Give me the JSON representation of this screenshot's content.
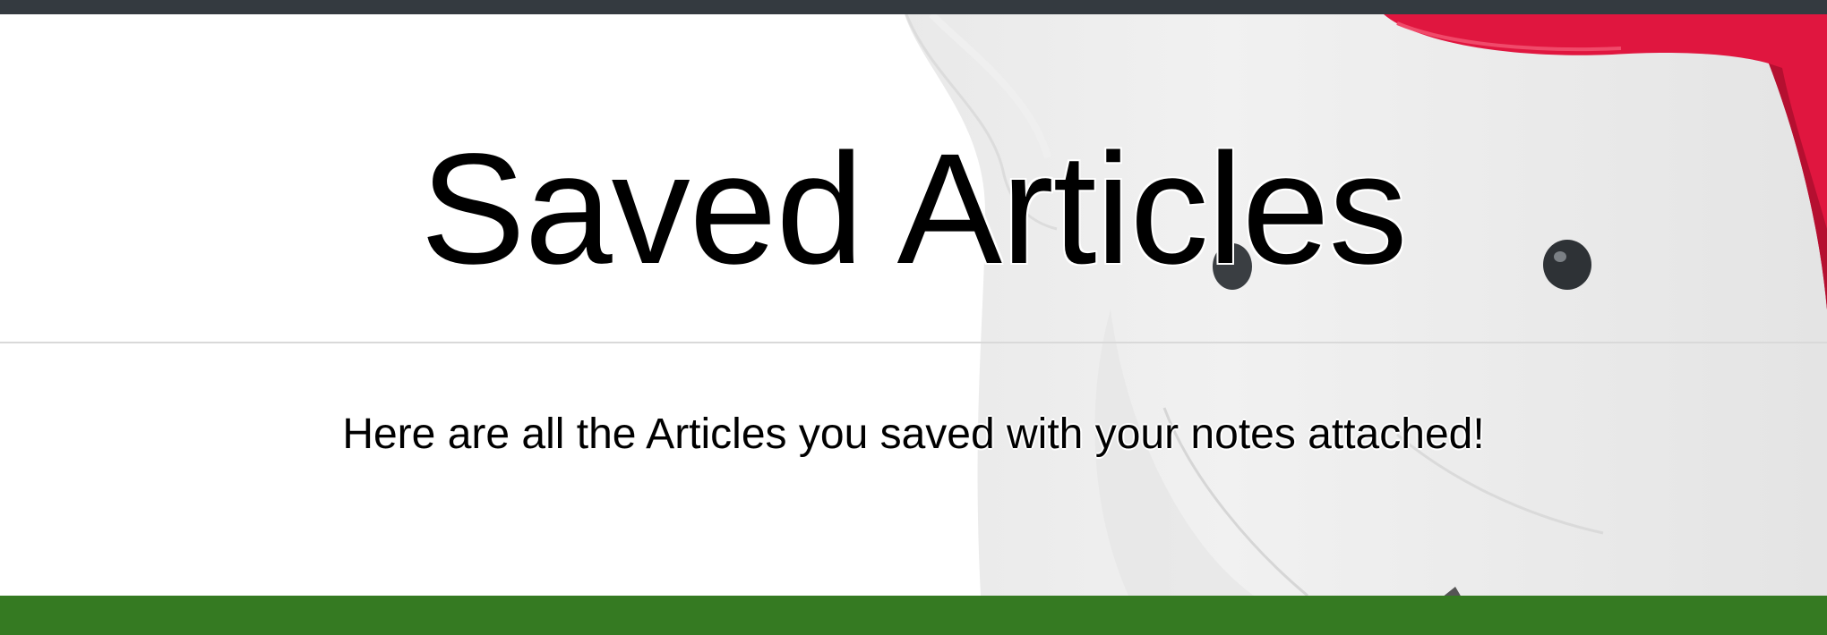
{
  "header": {
    "title": "Saved Articles"
  },
  "main": {
    "lead_text": "Here are all the Articles you saved with your notes attached!"
  },
  "colors": {
    "top_bar": "#343a40",
    "bottom_bar": "#357a22",
    "ribbon": "#e0163f",
    "text": "#000000"
  },
  "background": {
    "image": "piggy-bank-photo"
  }
}
